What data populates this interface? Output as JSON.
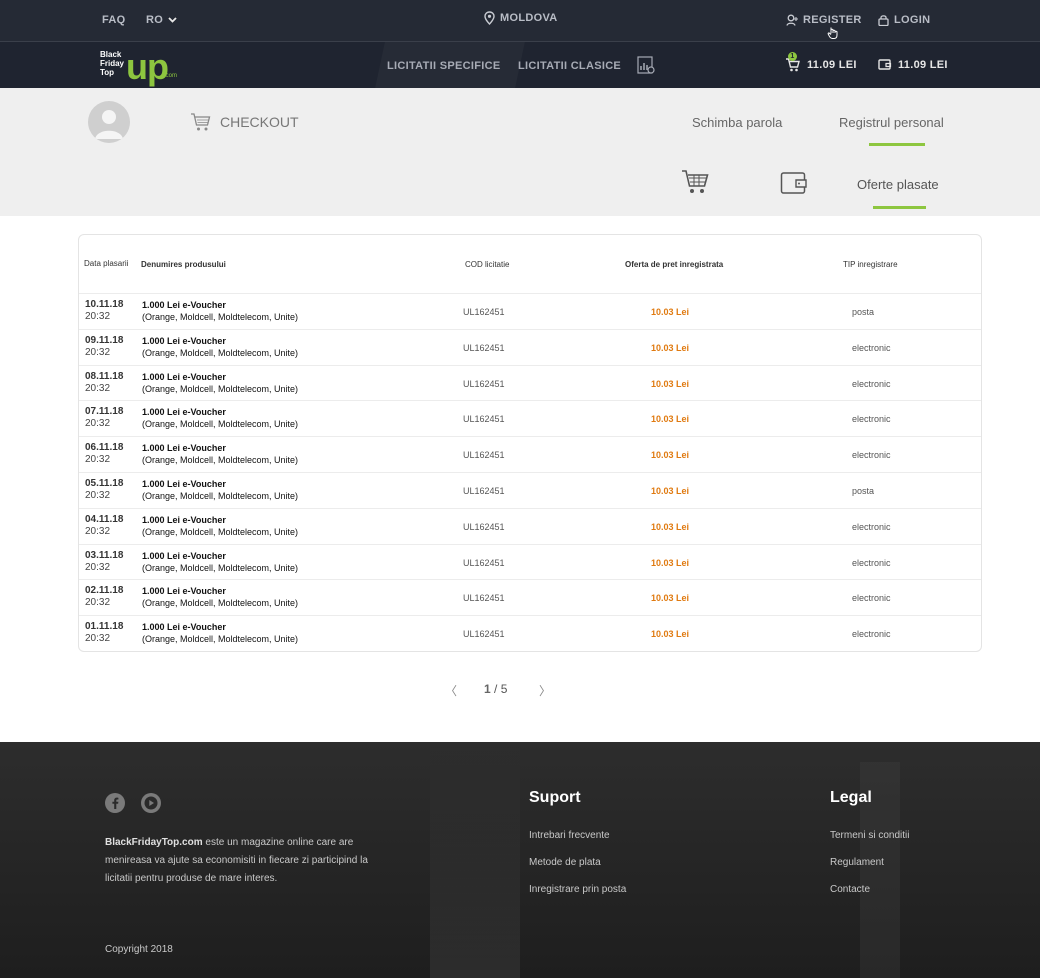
{
  "header": {
    "faq": "FAQ",
    "lang": "RO",
    "location": "MOLDOVA",
    "register": "REGISTER",
    "login": "LOGIN"
  },
  "nav": {
    "logo_lines": [
      "Black",
      "Friday",
      "Top"
    ],
    "logo_up": "up",
    "logo_com": ".com",
    "specific": "LICITATII SPECIFICE",
    "clasice": "LICITATII CLASICE",
    "cart_badge": "1",
    "cart_amount": "11.09 LEI",
    "wallet_amount": "11.09 LEI"
  },
  "account": {
    "checkout": "CHECKOUT",
    "schimba_parola": "Schimba parola",
    "registrul_personal": "Registrul personal",
    "oferte_plasate": "Oferte plasate"
  },
  "table": {
    "headers": {
      "date": "Data plasarii",
      "product": "Denumires produsului",
      "cod": "COD licitatie",
      "price": "Oferta de pret inregistrata",
      "tip": "TIP inregistrare"
    },
    "rows": [
      {
        "date": "10.11.18",
        "time": "20:32",
        "p1": "1.000 Lei e-Voucher",
        "p2": "(Orange, Moldcell, Moldtelecom, Unite)",
        "cod": "UL162451",
        "price": "10.03 Lei",
        "tip": "posta"
      },
      {
        "date": "09.11.18",
        "time": "20:32",
        "p1": "1.000 Lei e-Voucher",
        "p2": "(Orange, Moldcell, Moldtelecom, Unite)",
        "cod": "UL162451",
        "price": "10.03 Lei",
        "tip": "electronic"
      },
      {
        "date": "08.11.18",
        "time": "20:32",
        "p1": "1.000 Lei e-Voucher",
        "p2": "(Orange, Moldcell, Moldtelecom, Unite)",
        "cod": "UL162451",
        "price": "10.03 Lei",
        "tip": "electronic"
      },
      {
        "date": "07.11.18",
        "time": "20:32",
        "p1": "1.000 Lei e-Voucher",
        "p2": "(Orange, Moldcell, Moldtelecom, Unite)",
        "cod": "UL162451",
        "price": "10.03 Lei",
        "tip": "electronic"
      },
      {
        "date": "06.11.18",
        "time": "20:32",
        "p1": "1.000 Lei e-Voucher",
        "p2": "(Orange, Moldcell, Moldtelecom, Unite)",
        "cod": "UL162451",
        "price": "10.03 Lei",
        "tip": "electronic"
      },
      {
        "date": "05.11.18",
        "time": "20:32",
        "p1": "1.000 Lei e-Voucher",
        "p2": "(Orange, Moldcell, Moldtelecom, Unite)",
        "cod": "UL162451",
        "price": "10.03 Lei",
        "tip": "posta"
      },
      {
        "date": "04.11.18",
        "time": "20:32",
        "p1": "1.000 Lei e-Voucher",
        "p2": "(Orange, Moldcell, Moldtelecom, Unite)",
        "cod": "UL162451",
        "price": "10.03 Lei",
        "tip": "electronic"
      },
      {
        "date": "03.11.18",
        "time": "20:32",
        "p1": "1.000 Lei e-Voucher",
        "p2": "(Orange, Moldcell, Moldtelecom, Unite)",
        "cod": "UL162451",
        "price": "10.03 Lei",
        "tip": "electronic"
      },
      {
        "date": "02.11.18",
        "time": "20:32",
        "p1": "1.000 Lei e-Voucher",
        "p2": "(Orange, Moldcell, Moldtelecom, Unite)",
        "cod": "UL162451",
        "price": "10.03 Lei",
        "tip": "electronic"
      },
      {
        "date": "01.11.18",
        "time": "20:32",
        "p1": "1.000 Lei e-Voucher",
        "p2": "(Orange, Moldcell, Moldtelecom, Unite)",
        "cod": "UL162451",
        "price": "10.03 Lei",
        "tip": "electronic"
      }
    ]
  },
  "pagination": {
    "prev": "〈",
    "current": "1",
    "sep": " / ",
    "total": "5",
    "next": "〉"
  },
  "footer": {
    "about_brand": "BlackFridayTop.com",
    "about_text": " este un magazine online care are menireasa va ajute sa economisiti in fiecare zi participind la licitatii pentru produse de mare interes.",
    "copyright": "Copyright 2018",
    "suport_title": "Suport",
    "suport_links": [
      "Intrebari frecvente",
      "Metode de plata",
      "Inregistrare prin posta"
    ],
    "legal_title": "Legal",
    "legal_links": [
      "Termeni si conditii",
      "Regulament",
      "Contacte"
    ]
  },
  "colors": {
    "accent": "#8dc63f",
    "price": "#e07a10",
    "header_bg": "#252a35"
  }
}
